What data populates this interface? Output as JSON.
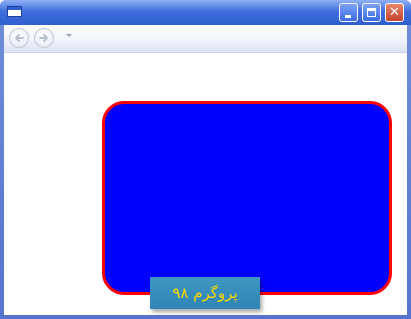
{
  "window": {
    "title": "",
    "icons": {
      "app": "window-icon",
      "minimize": "minimize-icon",
      "maximize": "maximize-icon",
      "close": "close-icon"
    },
    "close_symbol": "✕"
  },
  "navigation": {
    "back_icon": "back-arrow-icon",
    "forward_icon": "forward-arrow-icon",
    "history_dropdown_icon": "chevron-down-icon"
  },
  "content": {
    "shape": {
      "fill_color": "#0000ff",
      "border_color": "#ff0000"
    },
    "caption": {
      "text": "پروگرم ۹۸",
      "text_color": "#ffd700",
      "background_color": "#3690be"
    }
  }
}
